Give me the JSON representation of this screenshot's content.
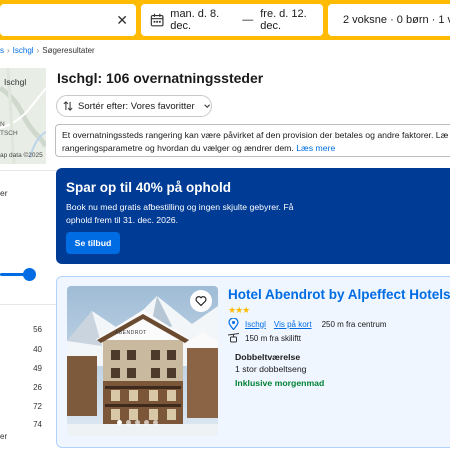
{
  "search": {
    "destination_value": "",
    "dates": {
      "checkin": "man. d. 8. dec.",
      "separator": "—",
      "checkout": "fre. d. 12. dec."
    },
    "guests": "2 voksne · 0 børn · 1 væ"
  },
  "breadcrumb": {
    "items": [
      {
        "label": "s",
        "link": true
      },
      {
        "label": "Ischgl",
        "link": true
      },
      {
        "label": "Søgeresultater",
        "link": false
      }
    ]
  },
  "map": {
    "labels": [
      "Ischgl",
      "N",
      "TSCH"
    ],
    "copyright": "ap data ©2025"
  },
  "sidebar": {
    "budget_label": "er",
    "counts": [
      "56",
      "40",
      "49",
      "26",
      "72",
      "74"
    ],
    "more_label": "er"
  },
  "results": {
    "title": "Ischgl: 106 overnatningssteder",
    "sort_label": "Sortér efter: Vores favoritter",
    "notice_text": "Et overnatningssteds rangering kan være påvirket af den provision der betales og andre faktorer. Læ rangeringsparametre og hvordan du vælger og ændrer dem.",
    "notice_link": "Læs mere"
  },
  "promo": {
    "title": "Spar op til 40% på ophold",
    "text": "Book nu med gratis afbestilling og ingen skjulte gebyrer. Få ophold frem til 31. dec. 2026.",
    "button": "Se tilbud"
  },
  "hotel": {
    "name": "Hotel Abendrot by Alpeffect Hotels",
    "stars": 3,
    "stars_text": "★★★",
    "location": "Ischgl",
    "map_link": "Vis på kort",
    "distance_center": "250 m fra centrum",
    "distance_lift": "150 m fra skiliftt",
    "room_type": "Dobbeltværelse",
    "bed": "1 stor dobbeltseng",
    "meal": "Inklusive morgenmad",
    "photo_sign": "ABENDROT",
    "photo_count": 5,
    "photo_active": 1
  },
  "colors": {
    "brand_yellow": "#febb02",
    "brand_blue": "#003b95",
    "link_blue": "#006ce4",
    "success_green": "#008234",
    "card_bg": "#f0f6ff"
  }
}
